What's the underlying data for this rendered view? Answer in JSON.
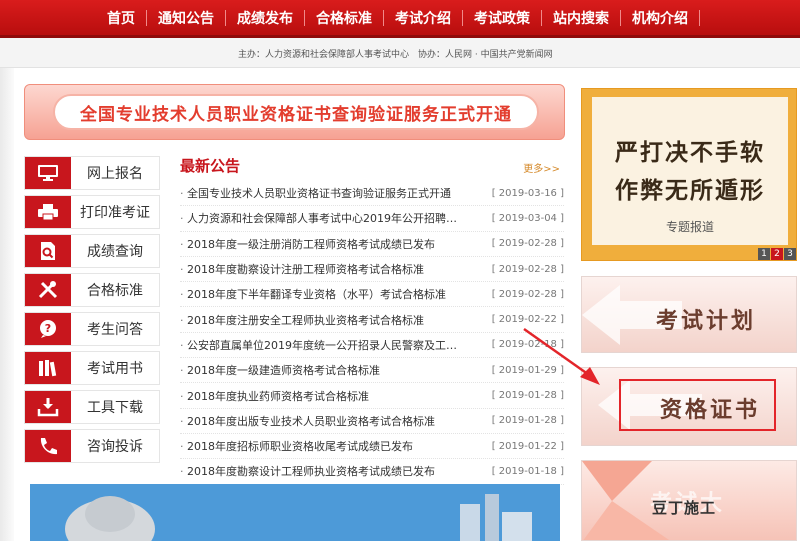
{
  "nav": {
    "items": [
      "首页",
      "通知公告",
      "成绩发布",
      "合格标准",
      "考试介绍",
      "考试政策",
      "站内搜索",
      "机构介绍"
    ]
  },
  "sponsor": "主办：人力资源和社会保障部人事考试中心　协办：人民网 · 中国共产党新闻网",
  "banner": {
    "text": "全国专业技术人员职业资格证书查询验证服务正式开通"
  },
  "menu": {
    "items": [
      {
        "label": "网上报名",
        "icon": "computer-icon"
      },
      {
        "label": "打印准考证",
        "icon": "printer-icon"
      },
      {
        "label": "成绩查询",
        "icon": "search-document-icon"
      },
      {
        "label": "合格标准",
        "icon": "tools-icon"
      },
      {
        "label": "考生问答",
        "icon": "question-icon"
      },
      {
        "label": "考试用书",
        "icon": "books-icon"
      },
      {
        "label": "工具下载",
        "icon": "download-icon"
      },
      {
        "label": "咨询投诉",
        "icon": "phone-icon"
      }
    ]
  },
  "notices": {
    "title": "最新公告",
    "more": "更多>>",
    "items": [
      {
        "text": "全国专业技术人员职业资格证书查询验证服务正式开通",
        "date": "[ 2019-03-16 ]"
      },
      {
        "text": "人力资源和社会保障部人事考试中心2019年公开招聘…",
        "date": "[ 2019-03-04 ]"
      },
      {
        "text": "2018年度一级注册消防工程师资格考试成绩已发布",
        "date": "[ 2019-02-28 ]"
      },
      {
        "text": "2018年度勘察设计注册工程师资格考试合格标准",
        "date": "[ 2019-02-28 ]"
      },
      {
        "text": "2018年度下半年翻译专业资格（水平）考试合格标准",
        "date": "[ 2019-02-28 ]"
      },
      {
        "text": "2018年度注册安全工程师执业资格考试合格标准",
        "date": "[ 2019-02-22 ]"
      },
      {
        "text": "公安部直属单位2019年度统一公开招录人民警察及工…",
        "date": "[ 2019-02-18 ]"
      },
      {
        "text": "2018年度一级建造师资格考试合格标准",
        "date": "[ 2019-01-29 ]"
      },
      {
        "text": "2018年度执业药师资格考试合格标准",
        "date": "[ 2019-01-28 ]"
      },
      {
        "text": "2018年度出版专业技术人员职业资格考试合格标准",
        "date": "[ 2019-01-28 ]"
      },
      {
        "text": "2018年度招标师职业资格收尾考试成绩已发布",
        "date": "[ 2019-01-22 ]"
      },
      {
        "text": "2018年度勘察设计工程师执业资格考试成绩已发布",
        "date": "[ 2019-01-18 ]"
      }
    ]
  },
  "promo": {
    "line1": "严打决不手软",
    "line2": "作弊无所遁形",
    "sub": "专题报道",
    "pager": [
      "1",
      "2",
      "3"
    ],
    "active_page": "2",
    "plan": "考试计划",
    "cert": "资格证书",
    "third": "考试大"
  },
  "watermark": "豆丁施工",
  "bottom_image": {
    "caption": ""
  },
  "colors": {
    "brand_red": "#c8161d",
    "nav_red": "#d91c1c",
    "banner_text": "#e33d2e",
    "promo_orange": "#f0ae3c"
  }
}
